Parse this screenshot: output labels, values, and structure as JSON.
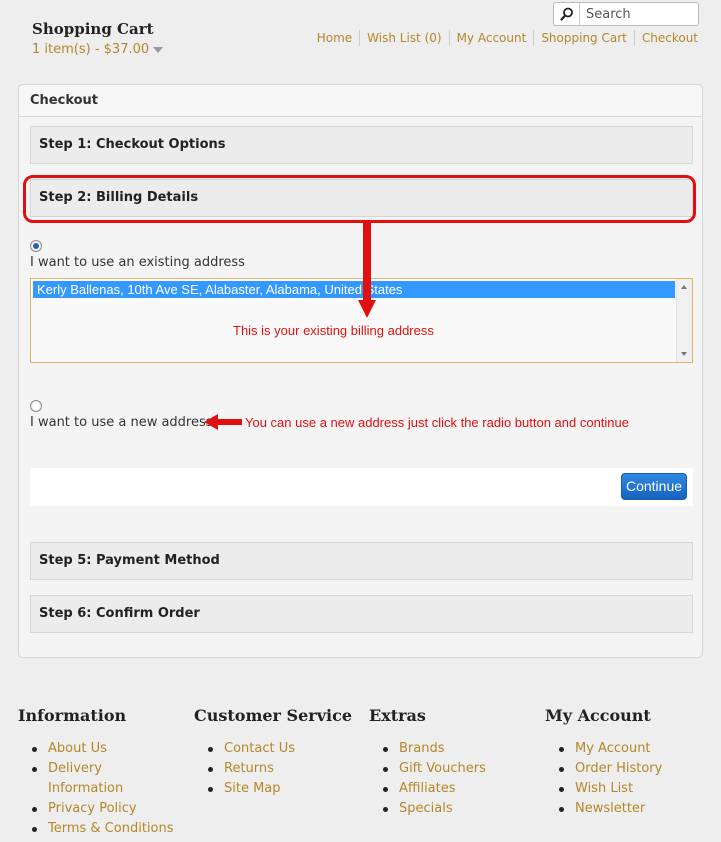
{
  "header": {
    "cart_title": "Shopping Cart",
    "cart_summary": "1 item(s) - $37.00",
    "search_placeholder": "Search",
    "links": [
      "Home",
      "Wish List (0)",
      "My Account",
      "Shopping Cart",
      "Checkout"
    ]
  },
  "checkout": {
    "heading": "Checkout",
    "step1": "Step 1: Checkout Options",
    "step2": "Step 2: Billing Details",
    "existing_label": "I want to use an existing address",
    "address_selected": "Kerly Ballenas, 10th Ave SE, Alabaster, Alabama, United States",
    "new_label": "I want to use a new address",
    "continue": "Continue",
    "step5": "Step 5: Payment Method",
    "step6": "Step 6: Confirm Order"
  },
  "annotations": {
    "existing_note": "This is your existing billing address",
    "new_note": "You can use a new address just click the radio button and continue",
    "color": "#e01010"
  },
  "footer": {
    "information": {
      "title": "Information",
      "items": [
        "About Us",
        "Delivery Information",
        "Privacy Policy",
        "Terms & Conditions"
      ]
    },
    "customer_service": {
      "title": "Customer Service",
      "items": [
        "Contact Us",
        "Returns",
        "Site Map"
      ]
    },
    "extras": {
      "title": "Extras",
      "items": [
        "Brands",
        "Gift Vouchers",
        "Affiliates",
        "Specials"
      ]
    },
    "my_account": {
      "title": "My Account",
      "items": [
        "My Account",
        "Order History",
        "Wish List",
        "Newsletter"
      ]
    }
  },
  "colors": {
    "link": "#b5872a",
    "button": "#1f70cf",
    "highlight": "#3399ff"
  }
}
